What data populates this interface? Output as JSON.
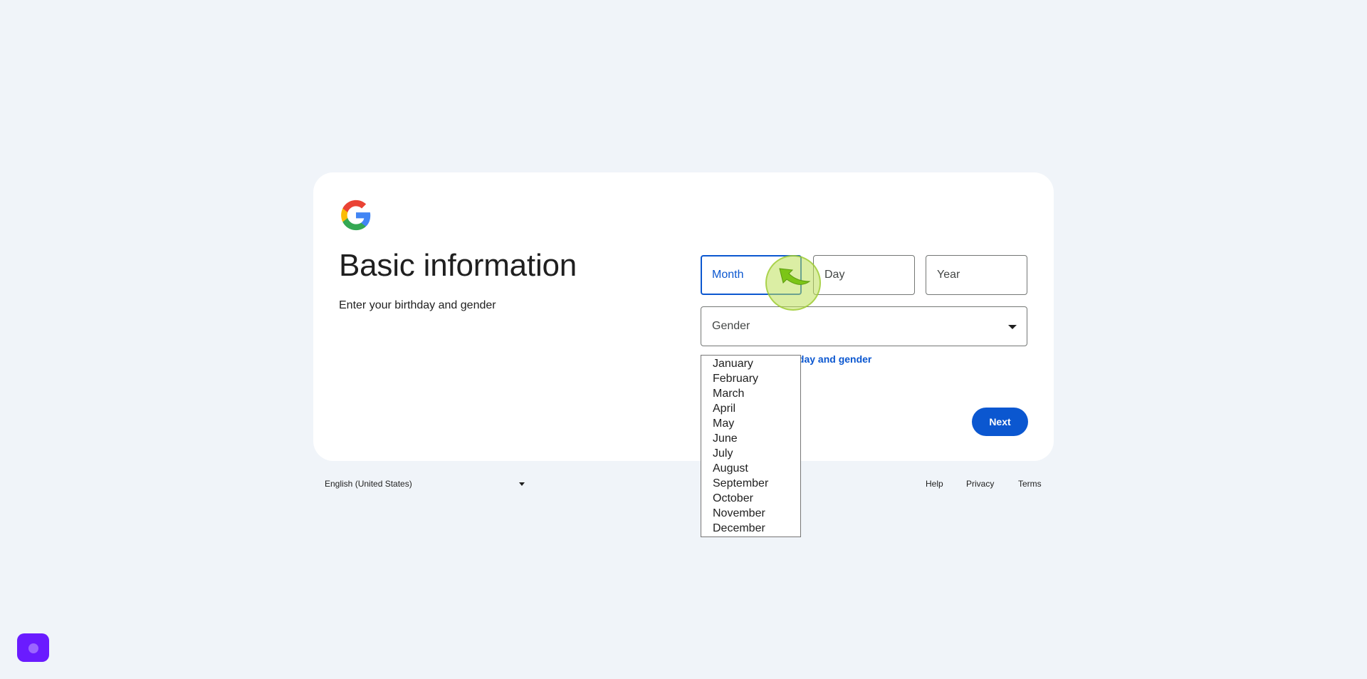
{
  "header": {
    "logo_icon": "google-g-logo-icon",
    "title": "Basic information",
    "subtitle": "Enter your birthday and gender"
  },
  "birthday": {
    "month": {
      "label": "Month",
      "state": "focused"
    },
    "day": {
      "label": "Day"
    },
    "year": {
      "label": "Year"
    }
  },
  "gender": {
    "label": "Gender",
    "icon": "dropdown-caret-icon"
  },
  "why_link": "Why we ask for birthday and gender",
  "actions": {
    "next_label": "Next"
  },
  "month_options": [
    "January",
    "February",
    "March",
    "April",
    "May",
    "June",
    "July",
    "August",
    "September",
    "October",
    "November",
    "December"
  ],
  "footer": {
    "language": "English (United States)",
    "links": {
      "help": "Help",
      "privacy": "Privacy",
      "terms": "Terms"
    }
  },
  "colors": {
    "page_background": "#f0f4f9",
    "accent": "#0b57d0",
    "card": "#ffffff",
    "cursor_highlight": "#bee05a",
    "extension_button": "#6a1bff"
  }
}
